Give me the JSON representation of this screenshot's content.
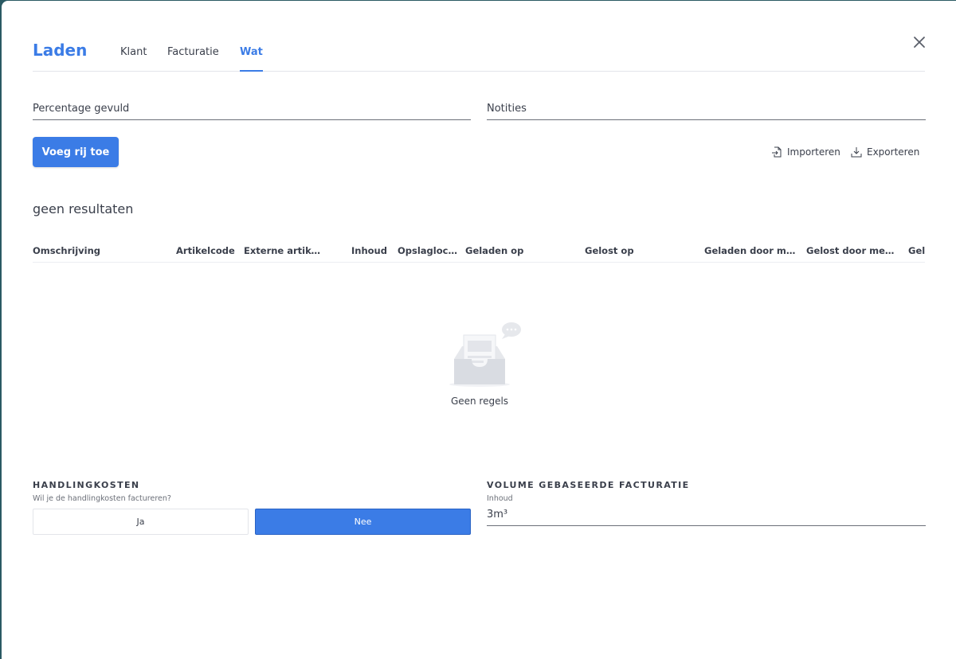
{
  "header": {
    "title": "Laden",
    "tabs": [
      {
        "label": "Klant"
      },
      {
        "label": "Facturatie"
      },
      {
        "label": "Wat",
        "active": true
      }
    ]
  },
  "form": {
    "percentage_label": "Percentage gevuld",
    "notes_label": "Notities"
  },
  "toolbar": {
    "add_row_label": "Voeg rij toe",
    "import_label": "Importeren",
    "export_label": "Exporteren"
  },
  "results": {
    "status_text": "geen resultaten",
    "columns": [
      "Omschrijving",
      "Artikelcode",
      "Externe artikelcode",
      "Inhoud",
      "Opslaglocatie",
      "Geladen op",
      "Gelost op",
      "Geladen door medewerker",
      "Gelost door medewerker",
      "Gel"
    ],
    "empty_text": "Geen regels"
  },
  "handling": {
    "title": "HANDLINGKOSTEN",
    "subtitle": "Wil je de handlingkosten factureren?",
    "yes_label": "Ja",
    "no_label": "Nee",
    "selected": "Nee"
  },
  "volume": {
    "title": "VOLUME GEBASEERDE FACTURATIE",
    "subtitle": "Inhoud",
    "value": "3m³"
  },
  "colors": {
    "accent": "#3b7ce6",
    "text": "#3a3f4b",
    "backdrop": "#2a5a63"
  }
}
